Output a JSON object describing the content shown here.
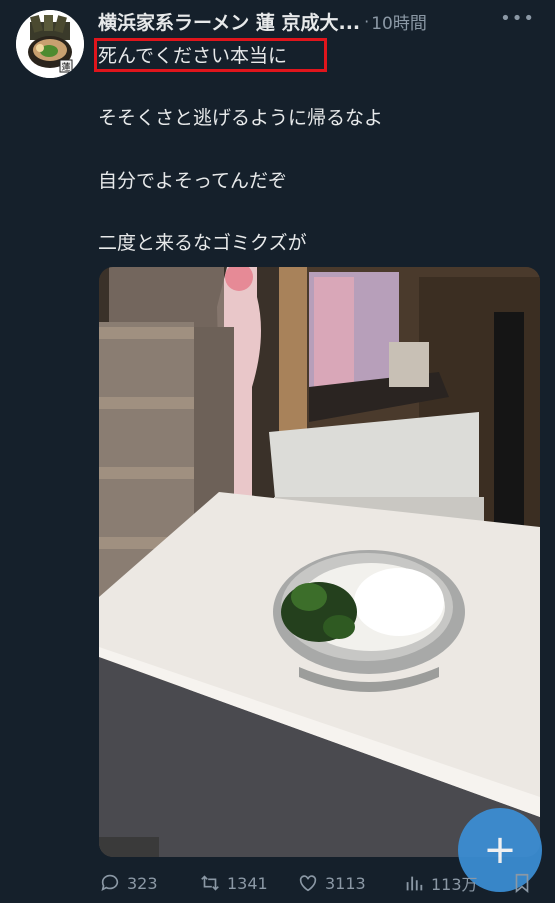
{
  "tweet": {
    "author_name": "横浜家系ラーメン 蓮 京成大...",
    "time": "10時間",
    "lines": [
      "死んでください本当に",
      "そそくさと逃げるように帰るなよ",
      "自分でよそってんだぞ",
      "二度と来るなゴミクズが"
    ],
    "avatar_seal_text": "蓮"
  },
  "actions": {
    "replies": "323",
    "retweets": "1341",
    "likes": "3113",
    "views": "113万"
  },
  "colors": {
    "background": "#15202b",
    "text": "#e7e9ea",
    "muted": "#8b98a5",
    "highlight_box": "#e0151c",
    "fab": "#3b8fd6"
  },
  "icons": [
    "more-icon",
    "reply-icon",
    "retweet-icon",
    "like-icon",
    "views-icon",
    "bookmark-icon",
    "plus-icon"
  ]
}
